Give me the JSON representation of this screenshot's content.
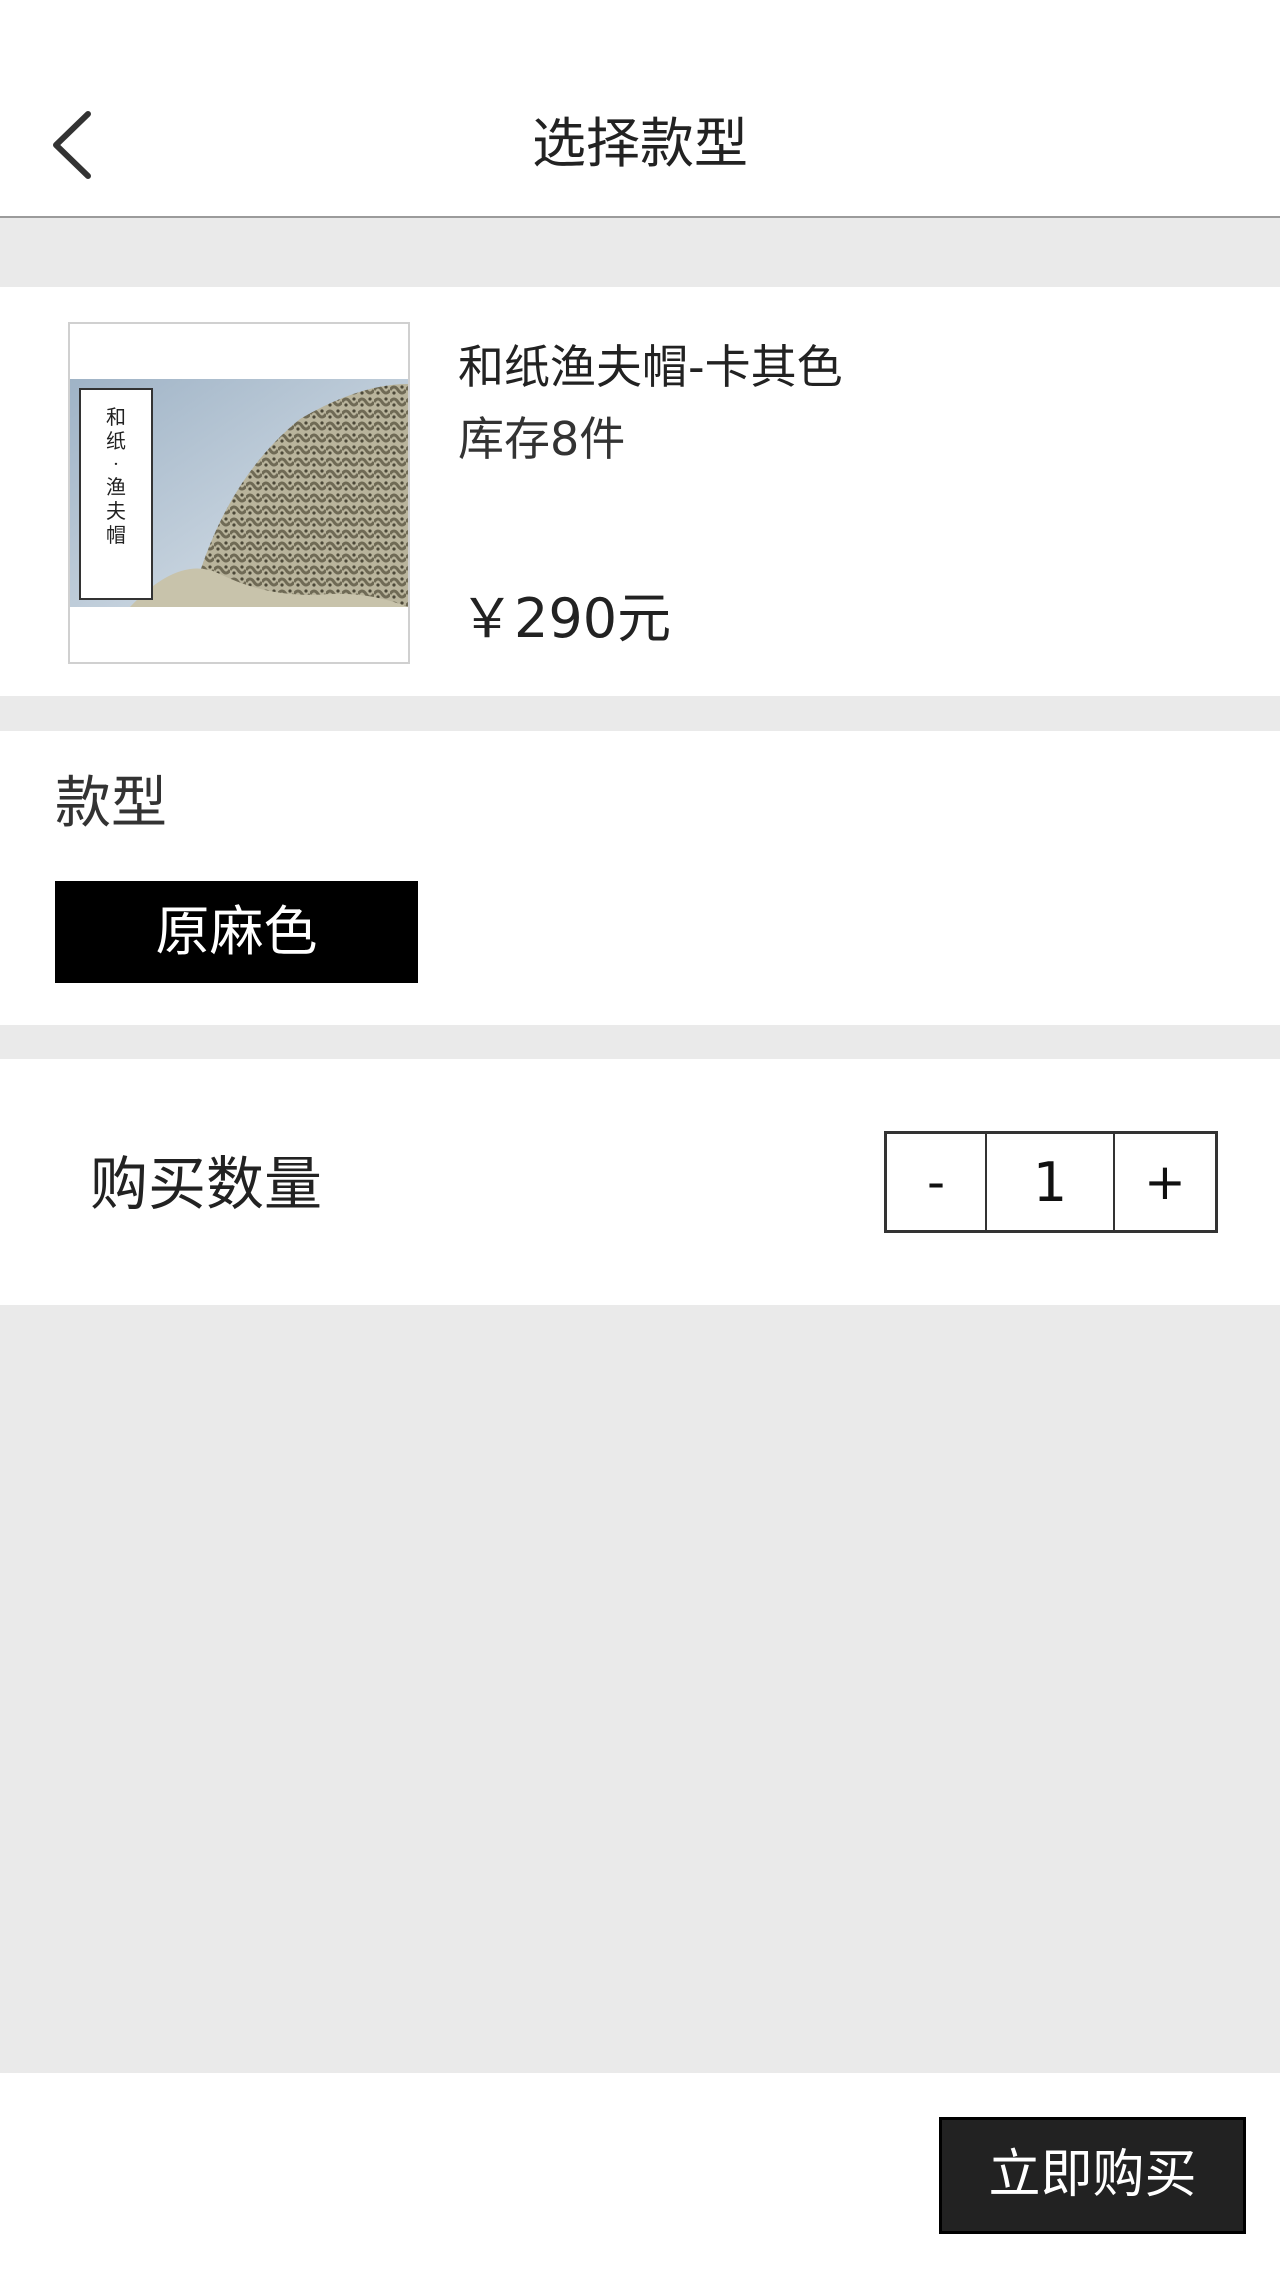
{
  "header": {
    "title": "选择款型",
    "back_icon": "chevron-left-icon"
  },
  "product": {
    "image_caption": "和纸·渔夫帽",
    "name": "和纸渔夫帽-卡其色",
    "stock": "库存8件",
    "price": "￥290元"
  },
  "style": {
    "label": "款型",
    "options": [
      "原麻色"
    ],
    "selected": "原麻色"
  },
  "quantity": {
    "label": "购买数量",
    "minus": "-",
    "value": "1",
    "plus": "+"
  },
  "footer": {
    "buy_label": "立即购买"
  },
  "colors": {
    "background": "#eaeaea",
    "card": "#ffffff",
    "selected_option": "#000000",
    "buy_button": "#222222"
  }
}
